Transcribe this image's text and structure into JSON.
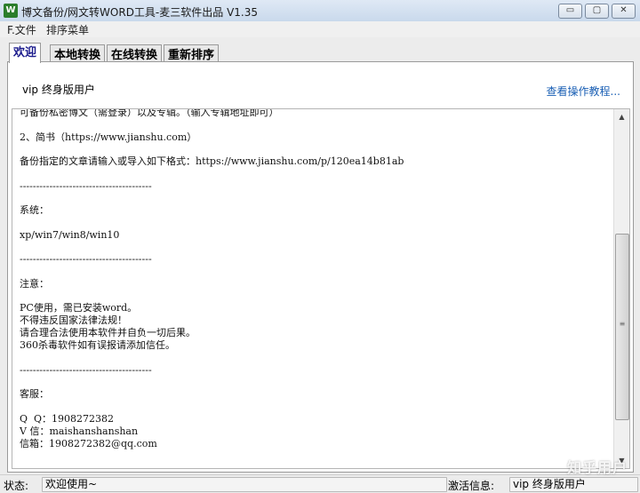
{
  "window": {
    "title": "博文备份/网文转WORD工具-麦三软件出品 V1.35",
    "icon": "app-w-icon"
  },
  "controls": {
    "minimize": "▭",
    "maximize": "▢",
    "close": "✕"
  },
  "menu": {
    "file": "F.文件",
    "sort": "排序菜单"
  },
  "tabs": [
    "欢迎",
    "本地转换",
    "在线转换",
    "重新排序"
  ],
  "panel": {
    "user_label": "vip 终身版用户",
    "help_link": "查看操作教程..."
  },
  "content": {
    "lines": [
      "可备份私密博文（需登录）以及专辑。（输入专辑地址即可）",
      "",
      "2、简书（https://www.jianshu.com）",
      "",
      "备份指定的文章请输入或导入如下格式：https://www.jianshu.com/p/120ea14b81ab",
      "",
      "----------------------------------------",
      "",
      "系统：",
      "",
      "xp/win7/win8/win10",
      "",
      "----------------------------------------",
      "",
      "注意：",
      "",
      "PC使用，需已安装word。",
      "不得违反国家法律法规！",
      "请合理合法使用本软件并自负一切后果。",
      "360杀毒软件如有误报请添加信任。",
      "",
      "----------------------------------------",
      "",
      "客服：",
      "",
      "Q  Q：1908272382",
      "V 信：maishanshanshan",
      "信箱：1908272382@qq.com"
    ]
  },
  "status": {
    "label": "状态:",
    "value": "欢迎使用~",
    "activation_label": "激活信息:",
    "activation_value": "vip 终身版用户"
  },
  "watermark": "知乎用户"
}
